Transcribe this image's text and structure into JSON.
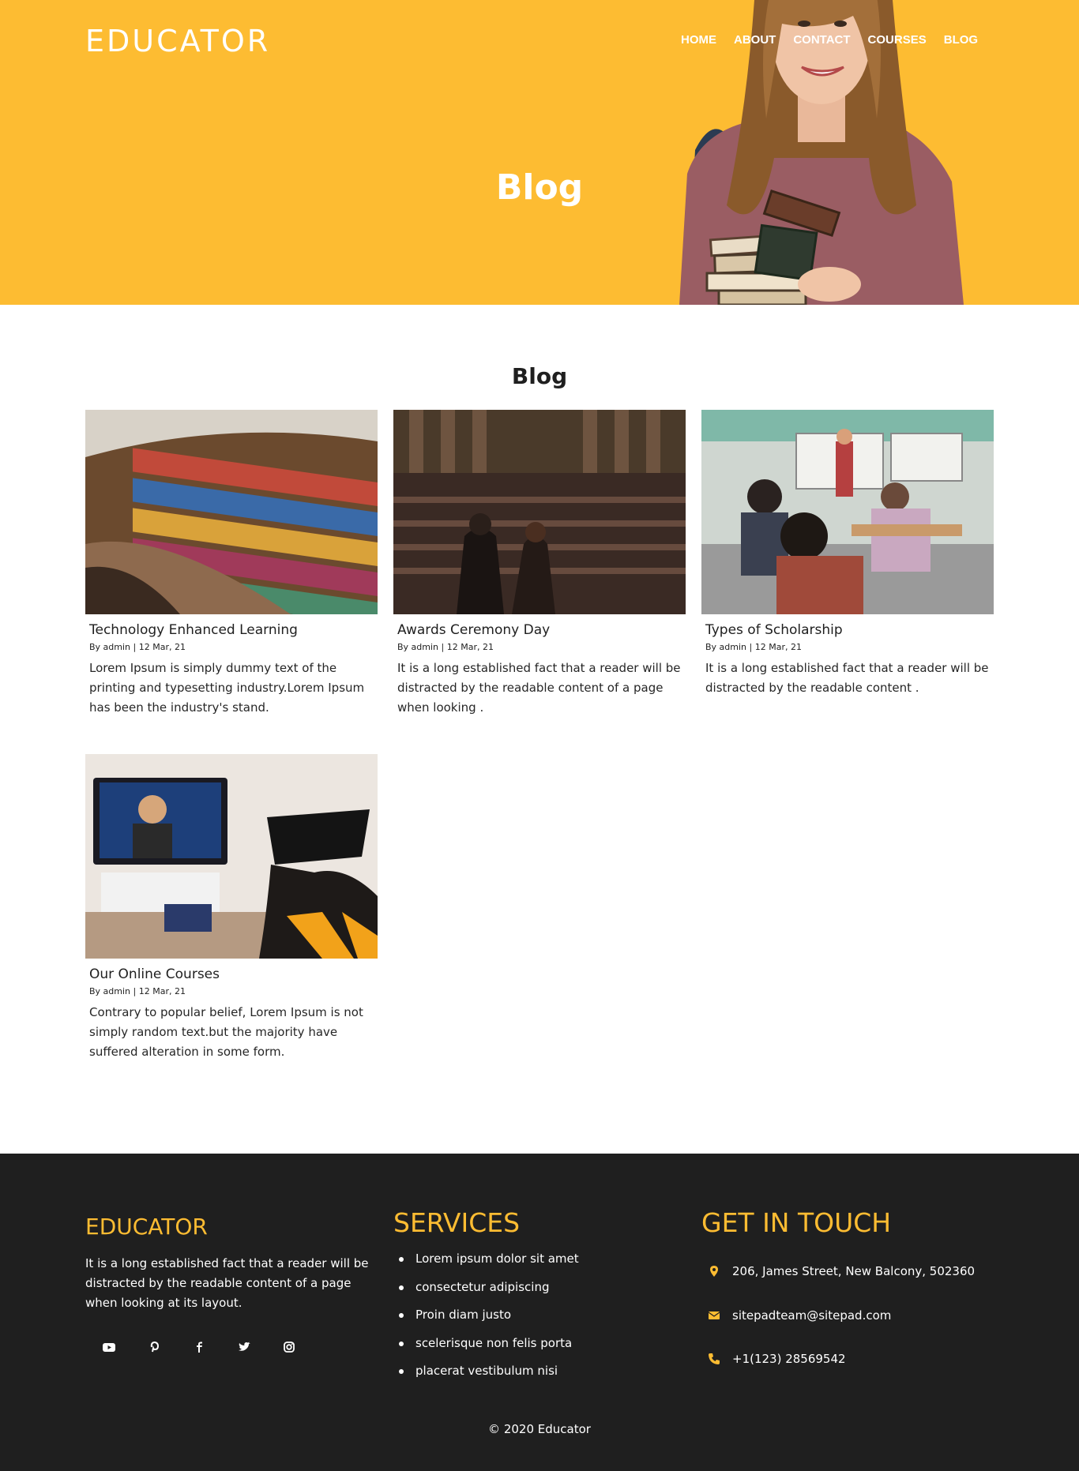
{
  "header": {
    "logo": "EDUCATOR",
    "nav": [
      "HOME",
      "ABOUT",
      "CONTACT",
      "COURSES",
      "BLOG"
    ],
    "hero_title": "Blog",
    "accent_color": "#fdbc32"
  },
  "blog": {
    "section_title": "Blog",
    "posts": [
      {
        "title": "Technology Enhanced Learning",
        "meta": "By admin | 12 Mar, 21",
        "excerpt": "Lorem Ipsum is simply dummy text of the printing and typesetting industry.Lorem Ipsum has been the industry's stand."
      },
      {
        "title": "Awards Ceremony Day",
        "meta": "By admin | 12 Mar, 21",
        "excerpt": "It is a long established fact that a reader will be distracted by the readable content of a page when looking ."
      },
      {
        "title": "Types of Scholarship",
        "meta": "By admin | 12 Mar, 21",
        "excerpt": "It is a long established fact that a reader will be distracted by the readable content ."
      },
      {
        "title": "Our Online Courses",
        "meta": "By admin | 12 Mar, 21",
        "excerpt": "Contrary to popular belief, Lorem Ipsum is not simply random text.but the majority have suffered alteration in some form."
      }
    ]
  },
  "footer": {
    "brand": "EDUCATOR",
    "about": "It is a long established fact that a reader will be distracted by the readable content of a page when looking at its layout.",
    "social_icons": [
      "youtube-icon",
      "pinterest-icon",
      "facebook-icon",
      "twitter-icon",
      "instagram-icon"
    ],
    "services_heading": "SERVICES",
    "services": [
      "Lorem ipsum dolor sit amet",
      "consectetur adipiscing",
      "Proin diam justo",
      "scelerisque non felis porta",
      "placerat vestibulum nisi"
    ],
    "contact_heading": "GET IN TOUCH",
    "address": "206, James Street, New Balcony, 502360",
    "email": "sitepadteam@sitepad.com",
    "phone": "+1(123) 28569542",
    "copyright": "© 2020 Educator",
    "background": "#1f1f1f"
  }
}
